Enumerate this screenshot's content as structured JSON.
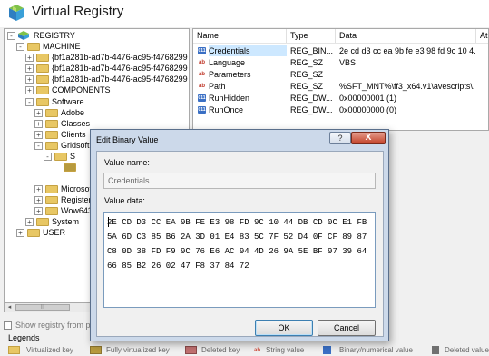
{
  "app": {
    "title": "Virtual Registry",
    "logo_icon": "cube-logo-icon"
  },
  "tree": {
    "nodes": [
      {
        "label": "REGISTRY",
        "icon": "registry-icon",
        "expander": "-"
      },
      {
        "label": "MACHINE",
        "icon": "folder-icon",
        "expander": "-"
      },
      {
        "label": "{bf1a281b-ad7b-4476-ac95-f4768299",
        "icon": "folder-icon",
        "expander": "+"
      },
      {
        "label": "{bf1a281b-ad7b-4476-ac95-f4768299",
        "icon": "folder-icon",
        "expander": "+"
      },
      {
        "label": "{bf1a281b-ad7b-4476-ac95-f4768299",
        "icon": "folder-icon",
        "expander": "+"
      },
      {
        "label": "COMPONENTS",
        "icon": "folder-icon",
        "expander": "+"
      },
      {
        "label": "Software",
        "icon": "folder-icon",
        "expander": "-"
      },
      {
        "label": "Adobe",
        "icon": "folder-icon",
        "expander": "+"
      },
      {
        "label": "Classes",
        "icon": "folder-icon",
        "expander": "+"
      },
      {
        "label": "Clients",
        "icon": "folder-icon",
        "expander": "+"
      },
      {
        "label": "Gridsoft",
        "icon": "folder-icon",
        "expander": "-"
      },
      {
        "label": "S",
        "icon": "folder-icon",
        "expander": "-"
      },
      {
        "label": "",
        "icon": "folder-icon",
        "expander": ""
      },
      {
        "label": "Microsoft",
        "icon": "folder-icon",
        "expander": "+"
      },
      {
        "label": "Registered",
        "icon": "folder-icon",
        "expander": "+"
      },
      {
        "label": "Wow6432Node",
        "icon": "folder-icon",
        "expander": "+"
      },
      {
        "label": "System",
        "icon": "folder-icon",
        "expander": "+"
      },
      {
        "label": "USER",
        "icon": "folder-icon",
        "expander": "+"
      }
    ],
    "scroll_left": "◂",
    "scroll_grip": "|||"
  },
  "table": {
    "columns": [
      "Name",
      "Type",
      "Data",
      "At"
    ],
    "rows": [
      {
        "name": "Credentials",
        "type": "REG_BIN...",
        "data": "2e cd d3 cc ea 9b fe e3 98 fd 9c 10 4...",
        "icon": "binary-value-icon",
        "icon_text": "011"
      },
      {
        "name": "Language",
        "type": "REG_SZ",
        "data": "VBS",
        "icon": "string-value-icon",
        "icon_text": "ab"
      },
      {
        "name": "Parameters",
        "type": "REG_SZ",
        "data": "",
        "icon": "string-value-icon",
        "icon_text": "ab"
      },
      {
        "name": "Path",
        "type": "REG_SZ",
        "data": "%SFT_MNT%\\ff3_x64.v1\\avescripts\\...",
        "icon": "string-value-icon",
        "icon_text": "ab"
      },
      {
        "name": "RunHidden",
        "type": "REG_DW...",
        "data": "0x00000001 (1)",
        "icon": "binary-value-icon",
        "icon_text": "011"
      },
      {
        "name": "RunOnce",
        "type": "REG_DW...",
        "data": "0x00000000 (0)",
        "icon": "binary-value-icon",
        "icon_text": "011"
      }
    ]
  },
  "show_registry_label": "Show registry from p",
  "legends": {
    "title": "Legends",
    "items": [
      {
        "label": "Virtualized key",
        "color": "#e8c764"
      },
      {
        "label": "Fully virtualized key",
        "color": "#b79a3e"
      },
      {
        "label": "Deleted key",
        "color": "#c07070"
      },
      {
        "label": "String value",
        "color": "#d04a3a"
      },
      {
        "label": "Binary/numerical value",
        "color": "#3a6fc4"
      },
      {
        "label": "Deleted value",
        "color": "#707070"
      }
    ]
  },
  "dialog": {
    "title": "Edit Binary Value",
    "help_label": "?",
    "close_label": "X",
    "value_name_label": "Value name:",
    "value_name": "Credentials",
    "value_data_label": "Value data:",
    "hex_lines": [
      "2E CD D3 CC EA 9B FE E3 98 FD 9C 10 44 DB CD 0C E1 FB",
      "5A 6D C3 85 B6 2A 3D 01 E4 83 5C 7F 52 D4 0F CF 89 87",
      "C8 0D 38 FD F9 9C 76 E6 AC 94 4D 26 9A 5E BF 97 39 64",
      "66 85 B2 26 02 47 F8 37 84 72"
    ],
    "ok_label": "OK",
    "cancel_label": "Cancel"
  }
}
